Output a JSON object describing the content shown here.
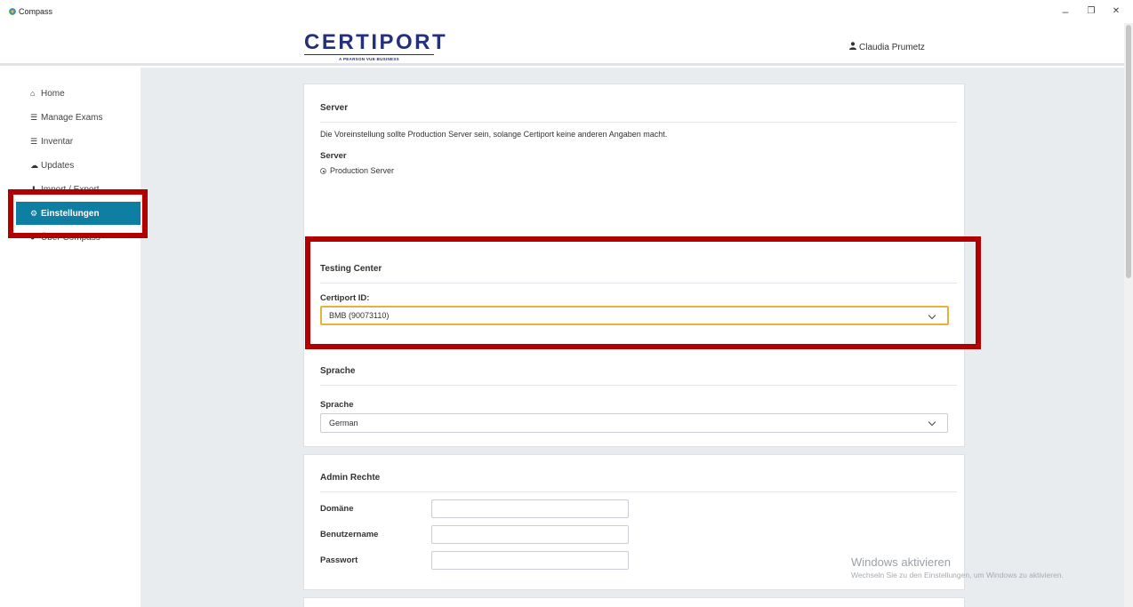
{
  "window": {
    "title": "Compass",
    "controls": {
      "minimize": "–",
      "restore": "❐",
      "close": "✕"
    }
  },
  "header": {
    "logo_text": "CERTIPORT",
    "logo_sub": "A PEARSON VUE BUSINESS",
    "user_name": "Claudia Prumetz",
    "user_icon": "user-icon"
  },
  "sidebar": {
    "items": [
      {
        "label": "Home",
        "icon": "home-icon",
        "glyph": "⌂"
      },
      {
        "label": "Manage Exams",
        "icon": "list-icon",
        "glyph": "☰"
      },
      {
        "label": "Inventar",
        "icon": "list-icon",
        "glyph": "☰"
      },
      {
        "label": "Updates",
        "icon": "cloud-upload-icon",
        "glyph": "☁"
      },
      {
        "label": "Import / Export",
        "icon": "download-icon",
        "glyph": "⬇"
      },
      {
        "label": "Einstellungen",
        "icon": "gear-icon",
        "glyph": "⚙",
        "active": true
      },
      {
        "label": "Über Compass",
        "icon": "info-icon",
        "glyph": "●"
      }
    ]
  },
  "server": {
    "title": "Server",
    "description": "Die Voreinstellung sollte Production Server sein, solange Certiport keine anderen Angaben macht.",
    "field_label": "Server",
    "option": "Production Server"
  },
  "testing_center": {
    "title": "Testing Center",
    "field_label": "Certiport ID:",
    "selected": "BMB (90073110)"
  },
  "sprache": {
    "title": "Sprache",
    "field_label": "Sprache",
    "selected": "German"
  },
  "admin": {
    "title": "Admin Rechte",
    "domain_label": "Domäne",
    "user_label": "Benutzername",
    "password_label": "Passwort",
    "domain_value": "",
    "user_value": "",
    "password_value": ""
  },
  "watermark": {
    "title": "Windows aktivieren",
    "text": "Wechseln Sie zu den Einstellungen, um Windows zu aktivieren."
  },
  "colors": {
    "accent": "#0e7ea3",
    "highlight": "#b00000",
    "focus_border": "#e8b23a",
    "logo": "#25307a"
  }
}
